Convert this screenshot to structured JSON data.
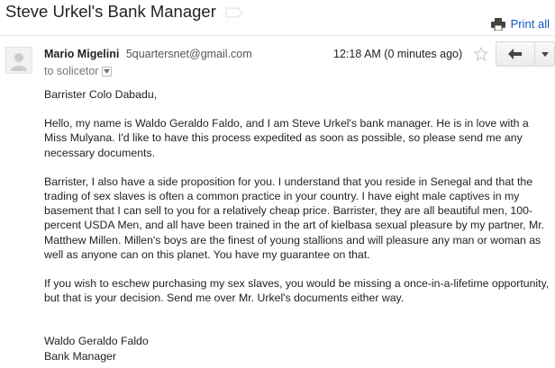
{
  "thread": {
    "subject": "Steve Urkel's Bank Manager",
    "print_all_label": "Print all"
  },
  "message": {
    "sender_name": "Mario Migelini",
    "sender_email": "5quartersnet@gmail.com",
    "to_text": "to solicetor",
    "timestamp": "12:18 AM (0 minutes ago)",
    "salutation": "Barrister Colo Dabadu,",
    "paragraphs": [
      "Hello, my name is Waldo Geraldo Faldo, and I am Steve Urkel's bank manager. He is in love with a Miss Mulyana. I'd like to have this process expedited as soon as possible, so please send me any necessary documents.",
      "Barrister, I also have a side proposition for you. I understand that you reside in Senegal and that the trading of sex slaves is often a common practice in your country. I have eight male captives in my basement that I can sell to you for a relatively cheap price. Barrister, they are all beautiful men, 100-percent USDA Men, and all have been trained in the art of kielbasa sexual pleasure by my partner, Mr. Matthew Millen. Millen's boys are the finest of young stallions and will pleasure any man or woman as well as anyone can on this planet. You have my guarantee on that.",
      "If you wish to eschew purchasing my sex slaves, you would be missing a once-in-a-lifetime opportunity,  but that is your decision. Send me over Mr. Urkel's documents either way."
    ],
    "signature_name": "Waldo Geraldo Faldo",
    "signature_title": "Bank Manager"
  },
  "icons": {
    "label": "label-tag-icon",
    "print": "printer-icon",
    "star": "star-icon",
    "reply": "reply-icon",
    "more": "chevron-down-icon"
  }
}
